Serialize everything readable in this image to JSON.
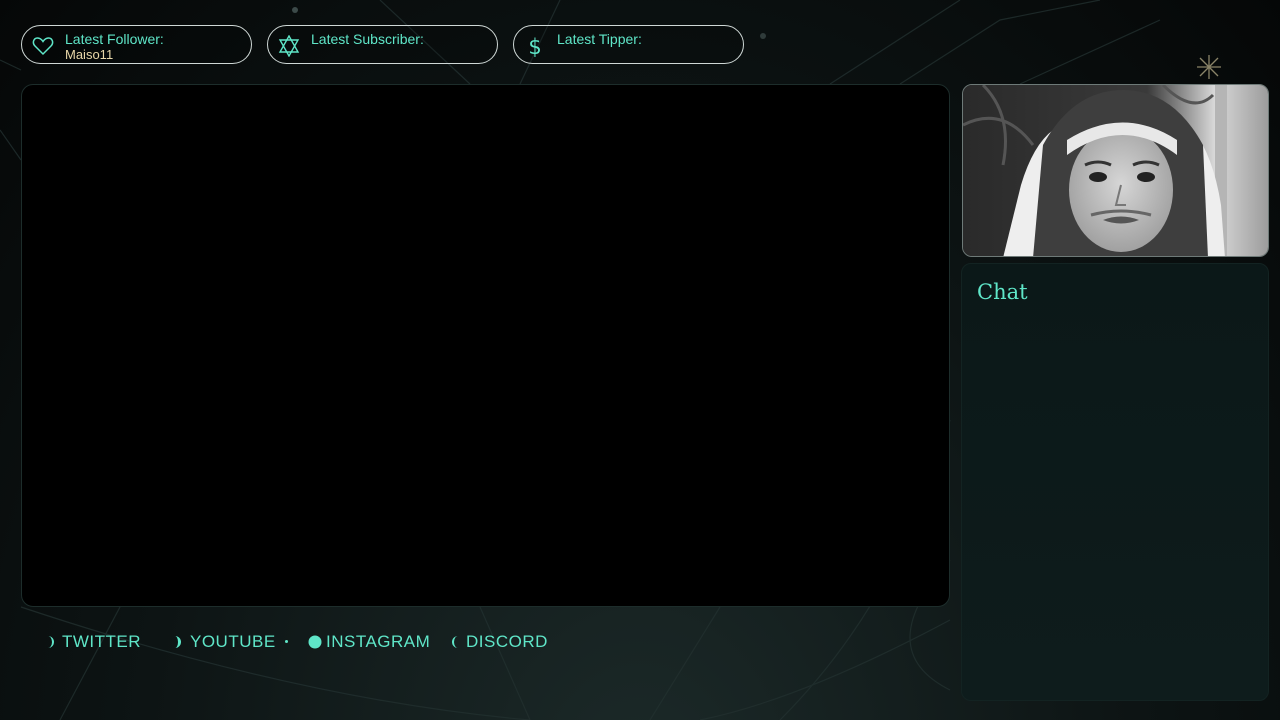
{
  "alerts": {
    "follower": {
      "label": "Latest Follower:",
      "value": "Maiso11",
      "icon": "heart-icon"
    },
    "subscriber": {
      "label": "Latest Subscriber:",
      "value": "",
      "icon": "star-of-david-icon"
    },
    "tipper": {
      "label": "Latest Tipper:",
      "value": "",
      "icon": "dollar-icon"
    }
  },
  "chat": {
    "title": "Chat"
  },
  "socials": [
    {
      "label": "TWITTER",
      "icon": "crescent-moon-icon"
    },
    {
      "label": "YOUTUBE",
      "icon": "crescent-moon-icon"
    },
    {
      "label": "INSTAGRAM",
      "icon": "full-moon-icon"
    },
    {
      "label": "DISCORD",
      "icon": "crescent-moon-icon"
    }
  ],
  "colors": {
    "accent": "#5fe6c8",
    "value_text": "#e8d7a8",
    "border": "#cfd8d6",
    "panel": "#0c1a1a"
  }
}
